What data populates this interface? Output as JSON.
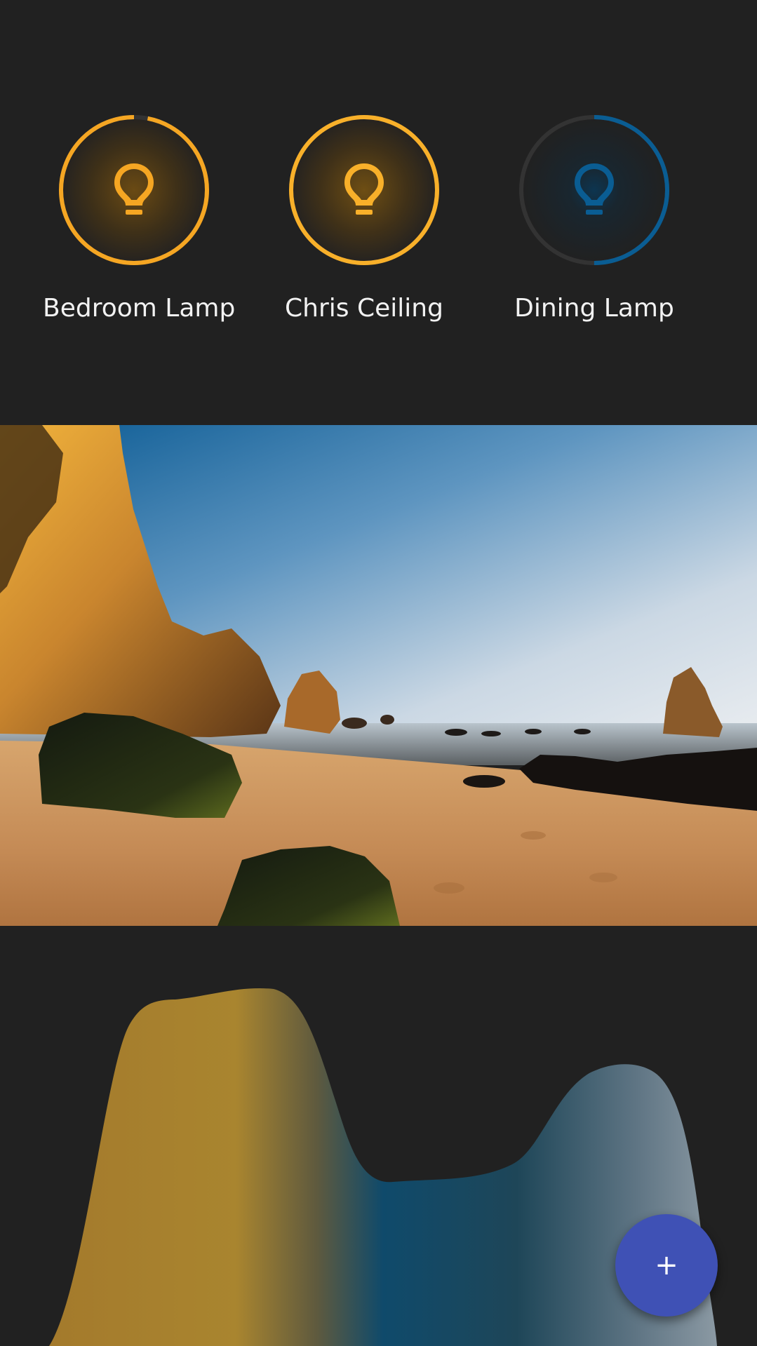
{
  "lamps": [
    {
      "name": "Bedroom Lamp",
      "on": true,
      "level": 0.97,
      "color": "#f5a623",
      "icon": "lightbulb-icon"
    },
    {
      "name": "Chris Ceiling",
      "on": true,
      "level": 1.0,
      "color": "#f8b02a",
      "icon": "lightbulb-icon"
    },
    {
      "name": "Dining Lamp",
      "on": false,
      "level": 0.5,
      "color": "#0a5d93",
      "icon": "lightbulb-icon"
    }
  ],
  "colors": {
    "background": "#212121",
    "ring_track": "#333333",
    "fab": "#3f51b5",
    "warm": "#a9852f",
    "cool": "#0f4a6b",
    "neutral": "#6b7f8d"
  },
  "fab": {
    "label": "+",
    "icon": "plus-icon"
  }
}
